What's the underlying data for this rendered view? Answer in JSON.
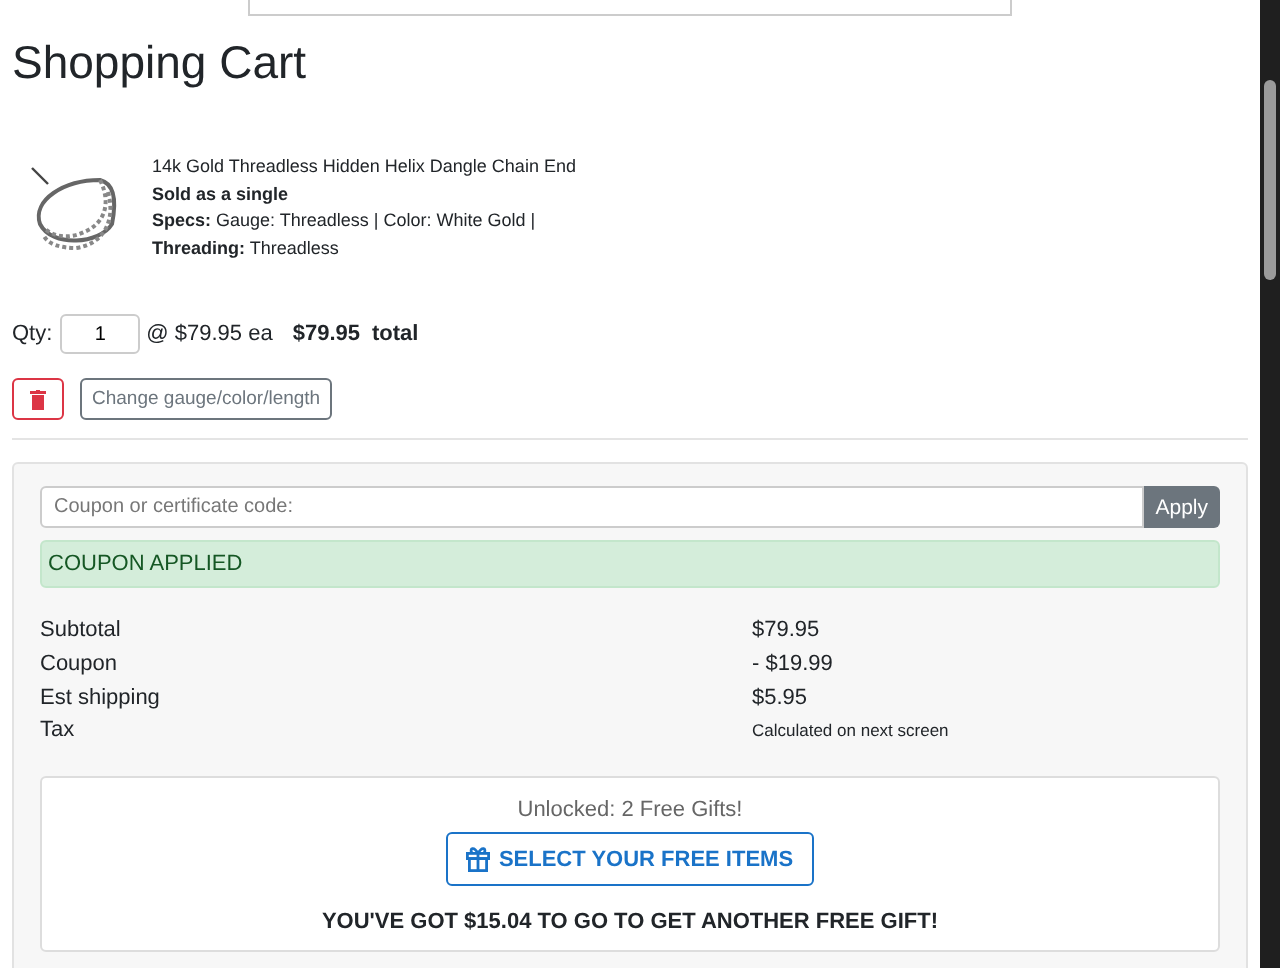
{
  "title": "Shopping Cart",
  "item": {
    "name": "14k Gold Threadless Hidden Helix Dangle Chain End",
    "sold_as": "Sold as a single",
    "specs": "**Specs:** Gauge: Threadless | Color: White Gold |",
    "threading": "**Threading:** Threadless",
    "qty_label": "Qty:",
    "qty": "1",
    "unit_price": "@ $79.95 ea",
    "total": "$79.95",
    "total_label": "total",
    "change_button": "Change gauge/color/length"
  },
  "coupon": {
    "placeholder": "Coupon or certificate code:",
    "apply": "Apply",
    "alert": "COUPON APPLIED"
  },
  "summary": [
    {
      "label": "Subtotal",
      "value": "$79.95",
      "kind": "amount"
    },
    {
      "label": "Coupon",
      "value": "- $19.99",
      "kind": "amount"
    },
    {
      "label": "Est shipping",
      "value": "$5.95",
      "kind": "amount"
    },
    {
      "label": "Tax",
      "value": "Calculated on next screen",
      "kind": "note"
    }
  ],
  "gifts": {
    "unlocked": "Unlocked: 2 Free Gifts!",
    "button": "SELECT YOUR FREE ITEMS",
    "message": "YOU'VE GOT **$15.04** TO GO TO GET ANOTHER FREE GIFT!"
  }
}
